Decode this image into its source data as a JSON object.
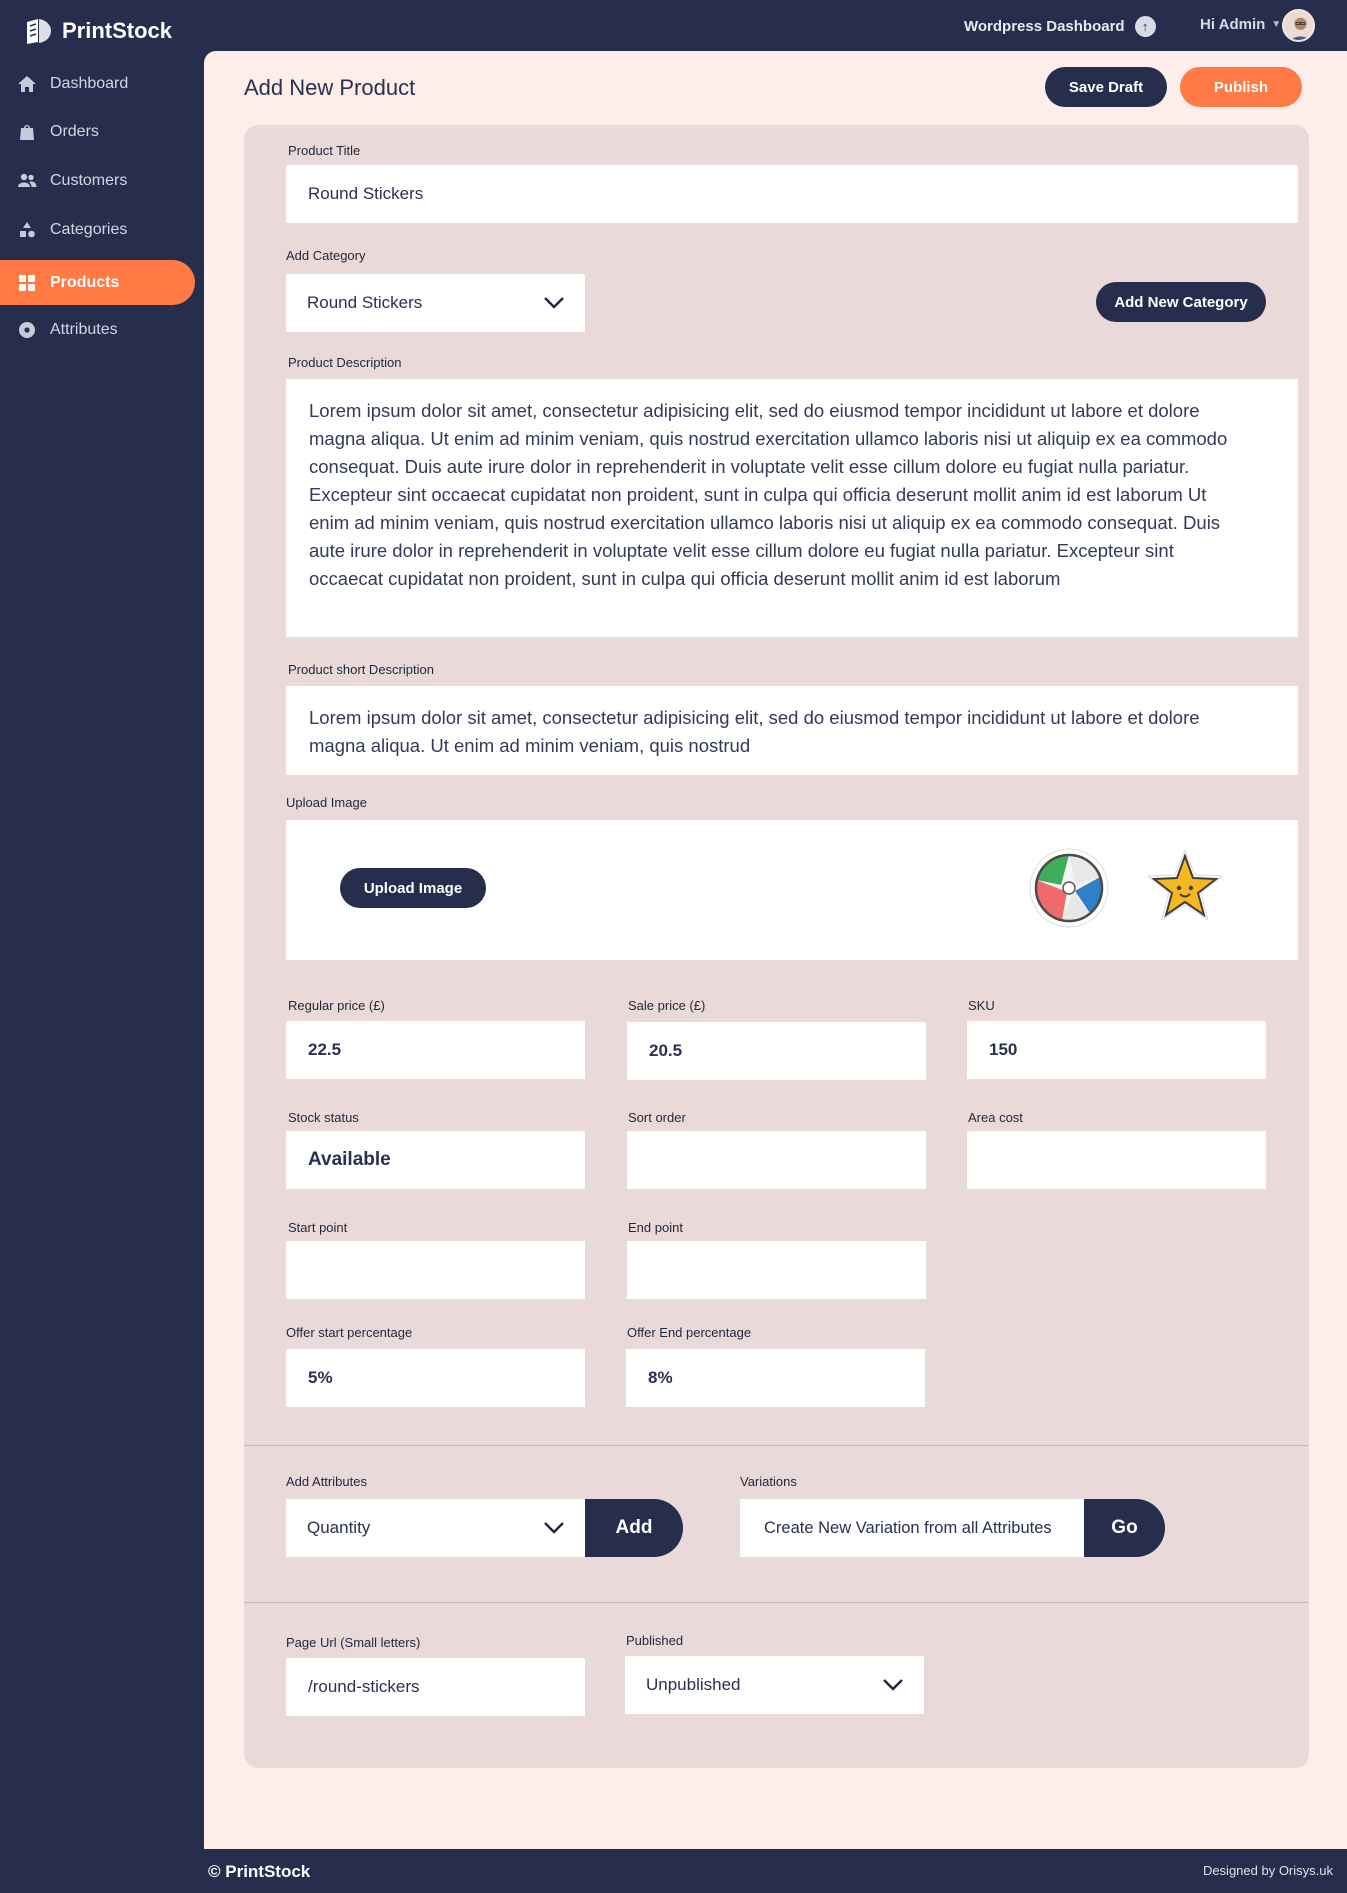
{
  "brand": {
    "name": "PrintStock"
  },
  "topbar": {
    "wp_dashboard": "Wordpress Dashboard",
    "greeting": "Hi Admin"
  },
  "sidebar": {
    "items": [
      {
        "label": "Dashboard",
        "icon": "home-icon"
      },
      {
        "label": "Orders",
        "icon": "bag-icon"
      },
      {
        "label": "Customers",
        "icon": "users-icon"
      },
      {
        "label": "Categories",
        "icon": "shapes-icon"
      },
      {
        "label": "Products",
        "icon": "grid-icon",
        "active": true
      },
      {
        "label": "Attributes",
        "icon": "gear-icon"
      }
    ]
  },
  "header": {
    "title": "Add New Product",
    "save_draft": "Save Draft",
    "publish": "Publish"
  },
  "form": {
    "product_title": {
      "label": "Product Title",
      "value": "Round Stickers"
    },
    "category": {
      "label": "Add Category",
      "value": "Round Stickers",
      "add_button": "Add New Category"
    },
    "description": {
      "label": "Product Description",
      "value": "Lorem ipsum dolor sit amet, consectetur adipisicing elit, sed do eiusmod tempor incididunt ut labore et dolore magna aliqua. Ut enim ad minim veniam, quis nostrud exercitation ullamco laboris nisi ut aliquip ex ea commodo consequat. Duis aute irure dolor in reprehenderit in voluptate velit esse cillum dolore eu fugiat nulla pariatur. Excepteur sint occaecat cupidatat non proident, sunt in culpa qui officia deserunt mollit anim id est laborum Ut enim ad minim veniam, quis nostrud exercitation ullamco laboris nisi ut aliquip ex ea commodo consequat. Duis aute irure dolor in reprehenderit in voluptate velit esse cillum dolore eu fugiat nulla pariatur. Excepteur sint occaecat cupidatat non proident, sunt in culpa qui officia deserunt mollit anim id est laborum"
    },
    "short_description": {
      "label": "Product short Description",
      "value": "Lorem ipsum dolor sit amet, consectetur adipisicing elit, sed do eiusmod tempor incididunt ut labore et dolore magna aliqua. Ut enim ad minim veniam, quis nostrud"
    },
    "upload": {
      "label": "Upload Image",
      "button": "Upload Image",
      "images": [
        "beach-ball-sticker",
        "star-sticker"
      ]
    },
    "regular_price": {
      "label": "Regular price (£)",
      "value": "22.5"
    },
    "sale_price": {
      "label": "Sale price (£)",
      "value": "20.5"
    },
    "sku": {
      "label": "SKU",
      "value": "150"
    },
    "stock_status": {
      "label": "Stock status",
      "value": "Available"
    },
    "sort_order": {
      "label": "Sort order",
      "value": ""
    },
    "area_cost": {
      "label": "Area cost",
      "value": ""
    },
    "start_point": {
      "label": "Start point",
      "value": ""
    },
    "end_point": {
      "label": "End point",
      "value": ""
    },
    "offer_start": {
      "label": "Offer start percentage",
      "value": "5%"
    },
    "offer_end": {
      "label": "Offer End percentage",
      "value": "8%"
    },
    "attributes": {
      "label": "Add Attributes",
      "value": "Quantity",
      "button": "Add"
    },
    "variations": {
      "label": "Variations",
      "value": "Create New Variation from all Attributes",
      "button": "Go"
    },
    "page_url": {
      "label": "Page Url (Small letters)",
      "value": "/round-stickers"
    },
    "published": {
      "label": "Published",
      "value": "Unpublished"
    }
  },
  "footer": {
    "copyright": "© PrintStock",
    "credit": "Designed by Orisys.uk"
  },
  "colors": {
    "navy": "#262d4d",
    "accent": "#ff7a45",
    "page_bg": "#fdeeea",
    "panel_bg": "#e9dad9"
  }
}
